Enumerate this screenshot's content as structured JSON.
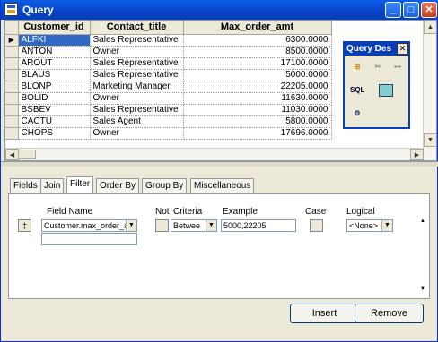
{
  "window": {
    "title": "Query"
  },
  "grid": {
    "columns": [
      "Customer_id",
      "Contact_title",
      "Max_order_amt"
    ],
    "rows": [
      [
        "ALFKI",
        "Sales Representative",
        "6300.0000"
      ],
      [
        "ANTON",
        "Owner",
        "8500.0000"
      ],
      [
        "AROUT",
        "Sales Representative",
        "17100.0000"
      ],
      [
        "BLAUS",
        "Sales Representative",
        "5000.0000"
      ],
      [
        "BLONP",
        "Marketing Manager",
        "22205.0000"
      ],
      [
        "BOLID",
        "Owner",
        "11630.0000"
      ],
      [
        "BSBEV",
        "Sales Representative",
        "11030.0000"
      ],
      [
        "CACTU",
        "Sales Agent",
        "5800.0000"
      ],
      [
        "CHOPS",
        "Owner",
        "17696.0000"
      ]
    ]
  },
  "query_designer": {
    "title": "Query Des",
    "sql_label": "SQL"
  },
  "tabs": [
    "Fields",
    "Join",
    "Filter",
    "Order By",
    "Group By",
    "Miscellaneous"
  ],
  "active_tab": "Filter",
  "filter": {
    "headers": {
      "field_name": "Field Name",
      "not": "Not",
      "criteria": "Criteria",
      "example": "Example",
      "case": "Case",
      "logical": "Logical"
    },
    "row": {
      "field_name": "Customer.max_order_am",
      "criteria": "Betwee",
      "example": "5000,22205",
      "logical": "<None>"
    }
  },
  "buttons": {
    "insert": "Insert",
    "remove": "Remove"
  }
}
